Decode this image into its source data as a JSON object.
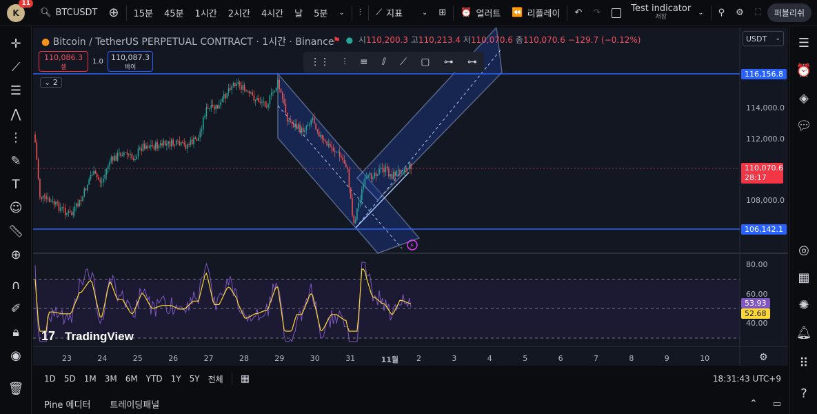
{
  "topbar": {
    "avatar_letter": "K",
    "notif_count": "11",
    "symbol": "BTCUSDT",
    "intervals": [
      "15분",
      "45분",
      "1시간",
      "2시간",
      "4시간",
      "날",
      "5분"
    ],
    "indicators_label": "지표",
    "alert_label": "얼러트",
    "replay_label": "리플레이",
    "layout_name": "Test indicator",
    "layout_sub": "저장",
    "publish_label": "퍼블리쉬"
  },
  "chart": {
    "title": "Bitcoin / TetherUS PERPETUAL CONTRACT · 1시간 · Binance",
    "ohlc": {
      "open_label": "시",
      "open": "110,200.3",
      "high_label": "고",
      "high": "110,213.4",
      "low_label": "저",
      "low": "110,070.6",
      "close_label": "종",
      "close": "110,070.6",
      "change": "−129.7 (−0.12%)"
    },
    "sell_price": "110,086.3",
    "sell_label": "셀",
    "spread": "1.0",
    "buy_price": "110,087.3",
    "buy_label": "바이",
    "indicator_count": "2",
    "currency": "USDT",
    "price_axis": [
      "114,000.0",
      "112,000.0",
      "108,000.0"
    ],
    "hline_top": "116,156.8",
    "hline_bottom": "106,142.1",
    "last_price": "110,070.6",
    "countdown": "28:17",
    "osc_axis": [
      "80.00",
      "60.00",
      "40.00"
    ],
    "osc_value1": "53.93",
    "osc_value2": "52.68",
    "watermark": "TradingView",
    "dates": [
      "23",
      "24",
      "25",
      "26",
      "27",
      "28",
      "29",
      "30",
      "31",
      "11월",
      "2",
      "3",
      "4",
      "5",
      "6",
      "7",
      "8",
      "9",
      "10"
    ]
  },
  "bottombar": {
    "ranges": [
      "1D",
      "5D",
      "1M",
      "3M",
      "6M",
      "YTD",
      "1Y",
      "5Y",
      "전체"
    ],
    "time": "18:31:43 UTC+9"
  },
  "bottomtabs": {
    "pine": "Pine 에디터",
    "trading": "트레이딩패널"
  },
  "colors": {
    "up": "#26a69a",
    "down": "#ef5350",
    "hline": "#2962ff",
    "channel": "#a3c4ff",
    "rsi": "#7e57c2",
    "rsi_ma": "#fdd835"
  },
  "chart_data": {
    "type": "line",
    "price_hlines": [
      116156.8,
      106142.1
    ],
    "last_price": 110070.6,
    "price_axis": [
      114000,
      112000,
      108000
    ],
    "osc_levels": [
      80,
      60,
      40
    ],
    "osc_last": [
      53.93,
      52.68
    ]
  }
}
